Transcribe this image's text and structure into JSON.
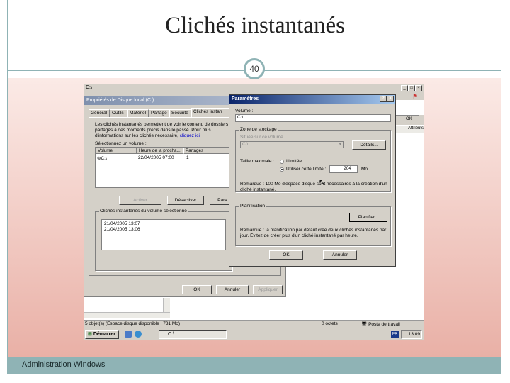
{
  "slide": {
    "title": "Clichés instantanés",
    "page_number": "40",
    "footer": "Administration Windows"
  },
  "explorer": {
    "title": "C:\\",
    "status_left": "5 objet(s) (Espace disque disponible : 731 Mo)",
    "status_mid": "0 octets",
    "status_right": "Poste de travail",
    "back_ok": "OK",
    "back_attributes": "Attributs"
  },
  "taskbar": {
    "start_label": "Démarrer",
    "task_item": "C:\\",
    "lang": "FR",
    "clock": "13:09"
  },
  "properties": {
    "title": "Propriétés de Disque local (C:)",
    "tabs": [
      "Général",
      "Outils",
      "Matériel",
      "Partage",
      "Sécurité",
      "Clichés instan"
    ],
    "description": "Les clichés instantanés permettent de voir le contenu de dossiers partagés à des moments précis dans le passé. Pour plus d'informations sur les clichés nécessaire, ",
    "description_link": "cliquez ici",
    "select_volume_label": "Sélectionnez un volume :",
    "columns": [
      "Volume",
      "Heure de la procha...",
      "Partages"
    ],
    "row": {
      "volume": "C:\\",
      "next_time": "22/04/2005 07:00",
      "shares": "1"
    },
    "activate_button": "Activer",
    "deactivate_button": "Désactiver",
    "settings_button": "Para",
    "snapshots_group": "Clichés instantanés du volume sélectionné",
    "snapshots": [
      "21/04/2005 13:07",
      "21/04/2005 13:06"
    ],
    "ok_button": "OK",
    "cancel_button": "Annuler",
    "apply_button": "Appliquer"
  },
  "settings": {
    "title": "Paramètres",
    "help_btn": "?",
    "close_btn": "×",
    "volume_label": "Volume :",
    "volume_value": "C:\\",
    "storage_group": "Zone de stockage",
    "located_label": "Située sur ce volume :",
    "located_value": "C:\\",
    "details_button": "Détails...",
    "max_size_label": "Taille maximale :",
    "unlimited_label": "Illimitée",
    "use_limit_label": "Utiliser cette limite :",
    "limit_value": "204",
    "limit_unit": "Mo",
    "storage_note": "Remarque : 100 Mo d'espace disque sont nécessaires à la création d'un cliché instantané.",
    "schedule_group": "Planification",
    "schedule_button": "Planifier...",
    "schedule_note": "Remarque : la planification par défaut crée deux clichés instantanés par jour. Évitez de créer plus d'un cliché instantané par heure.",
    "ok_button": "OK",
    "cancel_button": "Annuler"
  }
}
